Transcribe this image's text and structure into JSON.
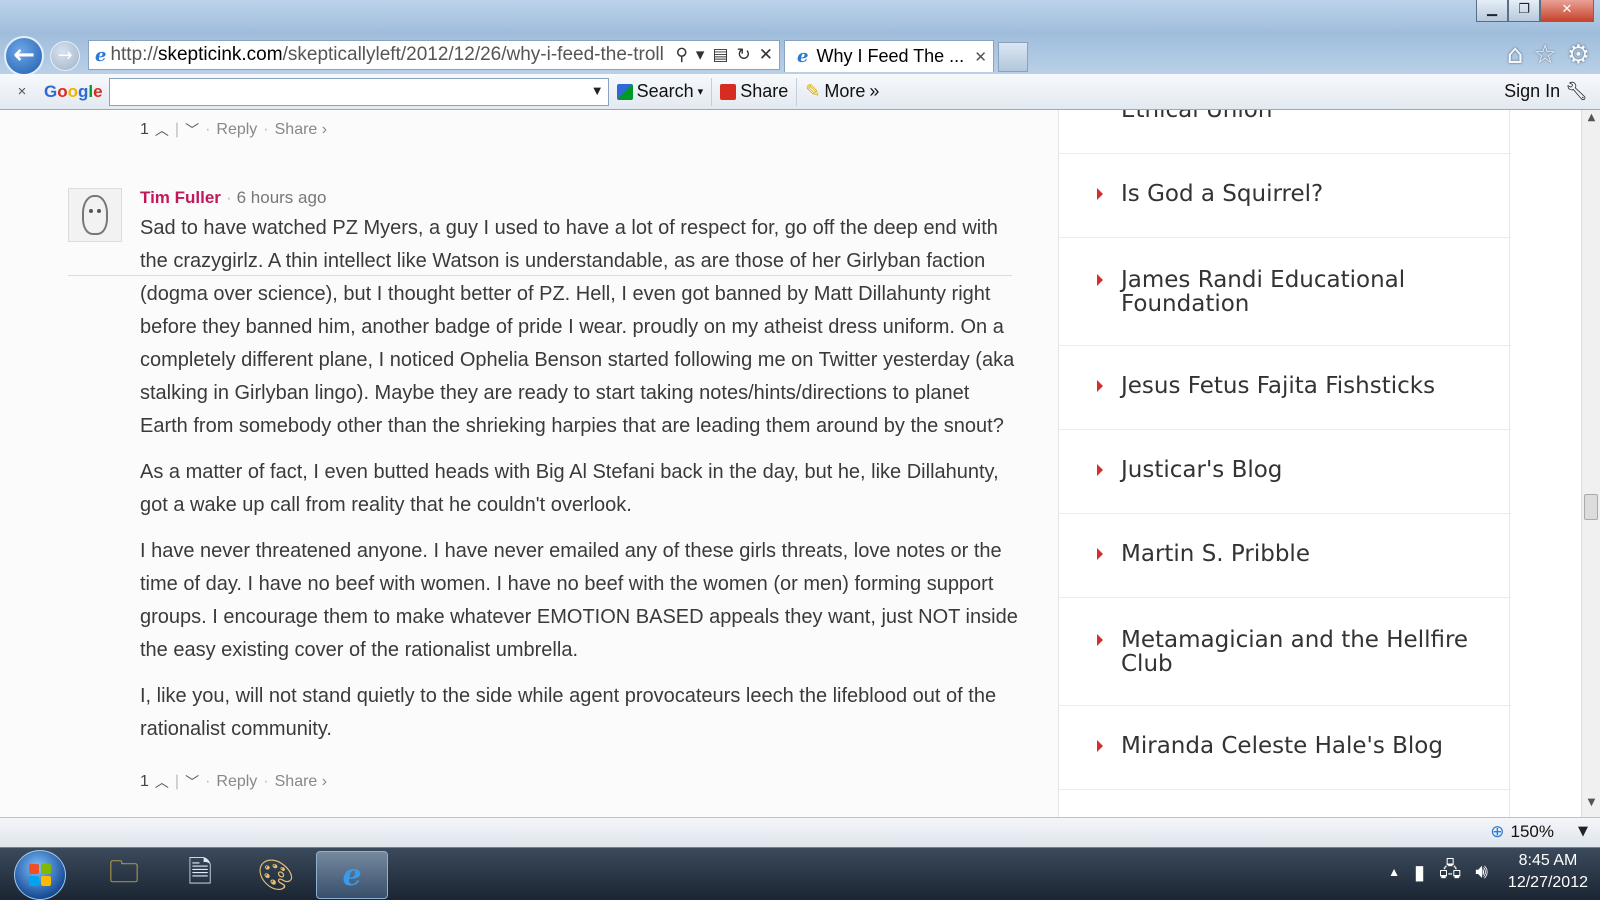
{
  "window": {
    "minimize": "▁",
    "restore": "❐",
    "close": "✕"
  },
  "browser": {
    "address_prefix": "http://",
    "address_host": "skepticink.com",
    "address_path": "/skepticallyleft/2012/12/26/why-i-feed-the-troll",
    "tab_title": "Why I Feed The ...",
    "tab_close": "✕"
  },
  "toolbar": {
    "close": "×",
    "logo_parts": [
      "G",
      "o",
      "o",
      "g",
      "l",
      "e"
    ],
    "search_label": "Search",
    "share_label": "Share",
    "more_label": "More",
    "more_chevrons": "»",
    "sign_in_label": "Sign In"
  },
  "comments": {
    "prev_vote": {
      "count": "1",
      "reply": "Reply",
      "share": "Share ›"
    },
    "comment": {
      "author": "Tim Fuller",
      "separator": "·",
      "time": "6 hours ago",
      "paragraphs": [
        "Sad to have watched PZ Myers, a guy I used to have a lot of respect for, go off the deep end with the crazygirlz. A thin intellect like Watson is understandable, as are those of her Girlyban faction (dogma over science), but I thought better of PZ. Hell, I even got banned by Matt Dillahunty right before they banned him, another badge of pride I wear. proudly on my atheist dress uniform. On a completely different plane, I noticed Ophelia Benson started following me on Twitter yesterday (aka stalking in Girlyban lingo). Maybe they are ready to start taking notes/hints/directions to planet Earth from somebody other than the shrieking harpies that are leading them around by the snout?",
        "As a matter of fact, I even butted heads with Big Al Stefani back in the day, but he, like Dillahunty, got a wake up call from reality that he couldn't overlook.",
        "I have never threatened anyone. I have never emailed any of these girls threats, love notes or the time of day. I have no beef with women. I have no beef with the women (or men) forming support groups. I encourage them to make whatever EMOTION BASED appeals they want, just NOT inside the easy existing cover of the rationalist umbrella.",
        "I, like you, will not stand quietly to the side while agent provocateurs leech the lifeblood out of the rationalist community."
      ],
      "vote": {
        "count": "1",
        "reply": "Reply",
        "share": "Share ›"
      }
    }
  },
  "sidebar": {
    "items": [
      {
        "label": "Ethical Union"
      },
      {
        "label": "Is God a Squirrel?"
      },
      {
        "label": "James Randi Educational Foundation"
      },
      {
        "label": "Jesus Fetus Fajita Fishsticks"
      },
      {
        "label": "Justicar's Blog"
      },
      {
        "label": "Martin S. Pribble"
      },
      {
        "label": "Metamagician and the Hellfire Club"
      },
      {
        "label": "Miranda Celeste Hale's Blog"
      }
    ]
  },
  "statusbar": {
    "zoom": "150%"
  },
  "taskbar": {
    "time": "8:45 AM",
    "date": "12/27/2012"
  },
  "colors": {
    "author": "#c2185b",
    "bullet": "#d32f2f",
    "accent_blue": "#1f5fb0"
  }
}
